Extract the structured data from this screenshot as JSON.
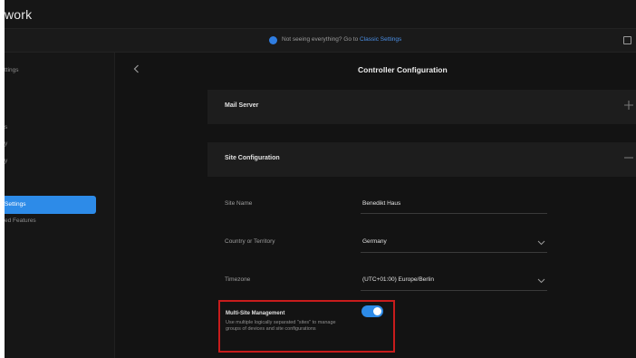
{
  "app": {
    "title": "work"
  },
  "notice": {
    "text": "Not seeing everything? Go to ",
    "link": "Classic Settings",
    "icon": "info-icon"
  },
  "sidebar": {
    "items": [
      {
        "label": "ttings"
      },
      {
        "label": "s"
      },
      {
        "label": "y"
      },
      {
        "label": "y"
      },
      {
        "label": "Settings",
        "active": true
      },
      {
        "label": "ed Features"
      }
    ]
  },
  "main": {
    "back_icon": "chevron-left-icon",
    "title": "Controller Configuration",
    "sections": [
      {
        "label": "Mail Server",
        "icon": "plus-icon",
        "expanded": false
      },
      {
        "label": "Site Configuration",
        "icon": "minus-icon",
        "expanded": true
      }
    ],
    "fields": [
      {
        "label": "Site Name",
        "value": "Benedikt Haus"
      },
      {
        "label": "Country or Territory",
        "value": "Germany",
        "dropdown": true
      },
      {
        "label": "Timezone",
        "value": "(UTC+01:00) Europe/Berlin",
        "dropdown": true
      }
    ],
    "multi_site": {
      "title": "Multi-Site Management",
      "description": "Use multiple logically separated \"sites\" to manage groups of devices and site configurations",
      "enabled": true
    }
  },
  "colors": {
    "accent": "#2d8be8",
    "highlight": "#c81c1c",
    "background": "#131313"
  }
}
